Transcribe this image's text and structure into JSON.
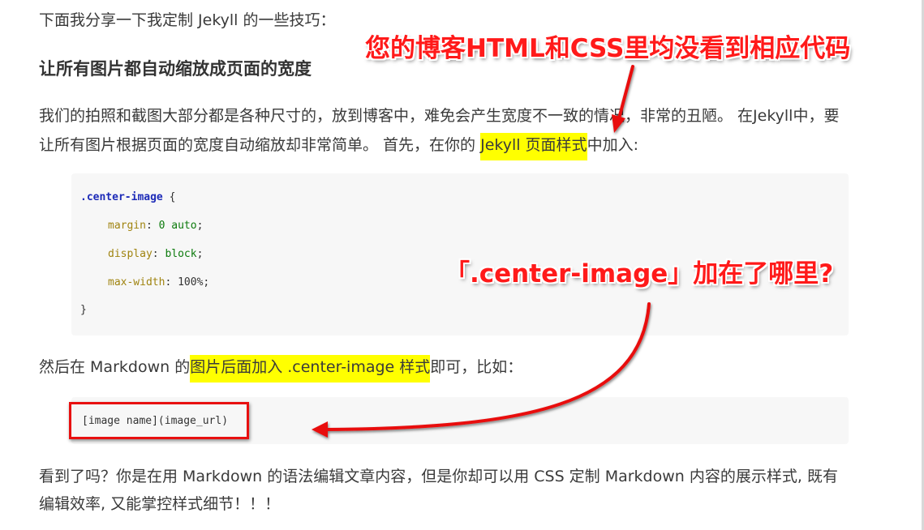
{
  "article": {
    "intro": "下面我分享一下我定制 Jekyll 的一些技巧：",
    "heading": "让所有图片都自动缩放成页面的宽度",
    "para1_line1": "我们的拍照和截图大部分都是各种尺寸的，放到博客中，难免会产生宽度不一致的情况，非常的丑陋。 在Jekyll中，要",
    "para1_line2_pre": "让所有图片根据页面的宽度自动缩放却非常简单。 首先，在你的 ",
    "para1_line2_hl": "Jekyll 页面样式",
    "para1_line2_post": "中加入:",
    "css_code": {
      "selector": ".center-image",
      "open_brace": " {",
      "line1_prop": "margin",
      "line1_val": "0 auto",
      "line2_prop": "display",
      "line2_val": "block",
      "line3_prop": "max-width",
      "line3_val": "100%",
      "close_brace": "}"
    },
    "para2_pre": "然后在 Markdown 的",
    "para2_hl": "图片后面加入 .center-image 样式",
    "para2_post": "即可，比如：",
    "md_code": {
      "part1": "[image name]",
      "part2": "(image_url)"
    },
    "para3_line1": "看到了吗？你是在用 Markdown 的语法编辑文章内容，但是你却可以用 CSS 定制 Markdown 内容的展示样式, 既有",
    "para3_line2": "编辑效率, 又能掌控样式细节！！！"
  },
  "annotations": {
    "top_note": "您的博客HTML和CSS里均没看到相应代码",
    "middle_note": "「.center-image」加在了哪里?"
  },
  "colors": {
    "highlight": "#ffff00",
    "annotation_red": "#ff1a1a",
    "code_background": "#f7f7f7"
  }
}
